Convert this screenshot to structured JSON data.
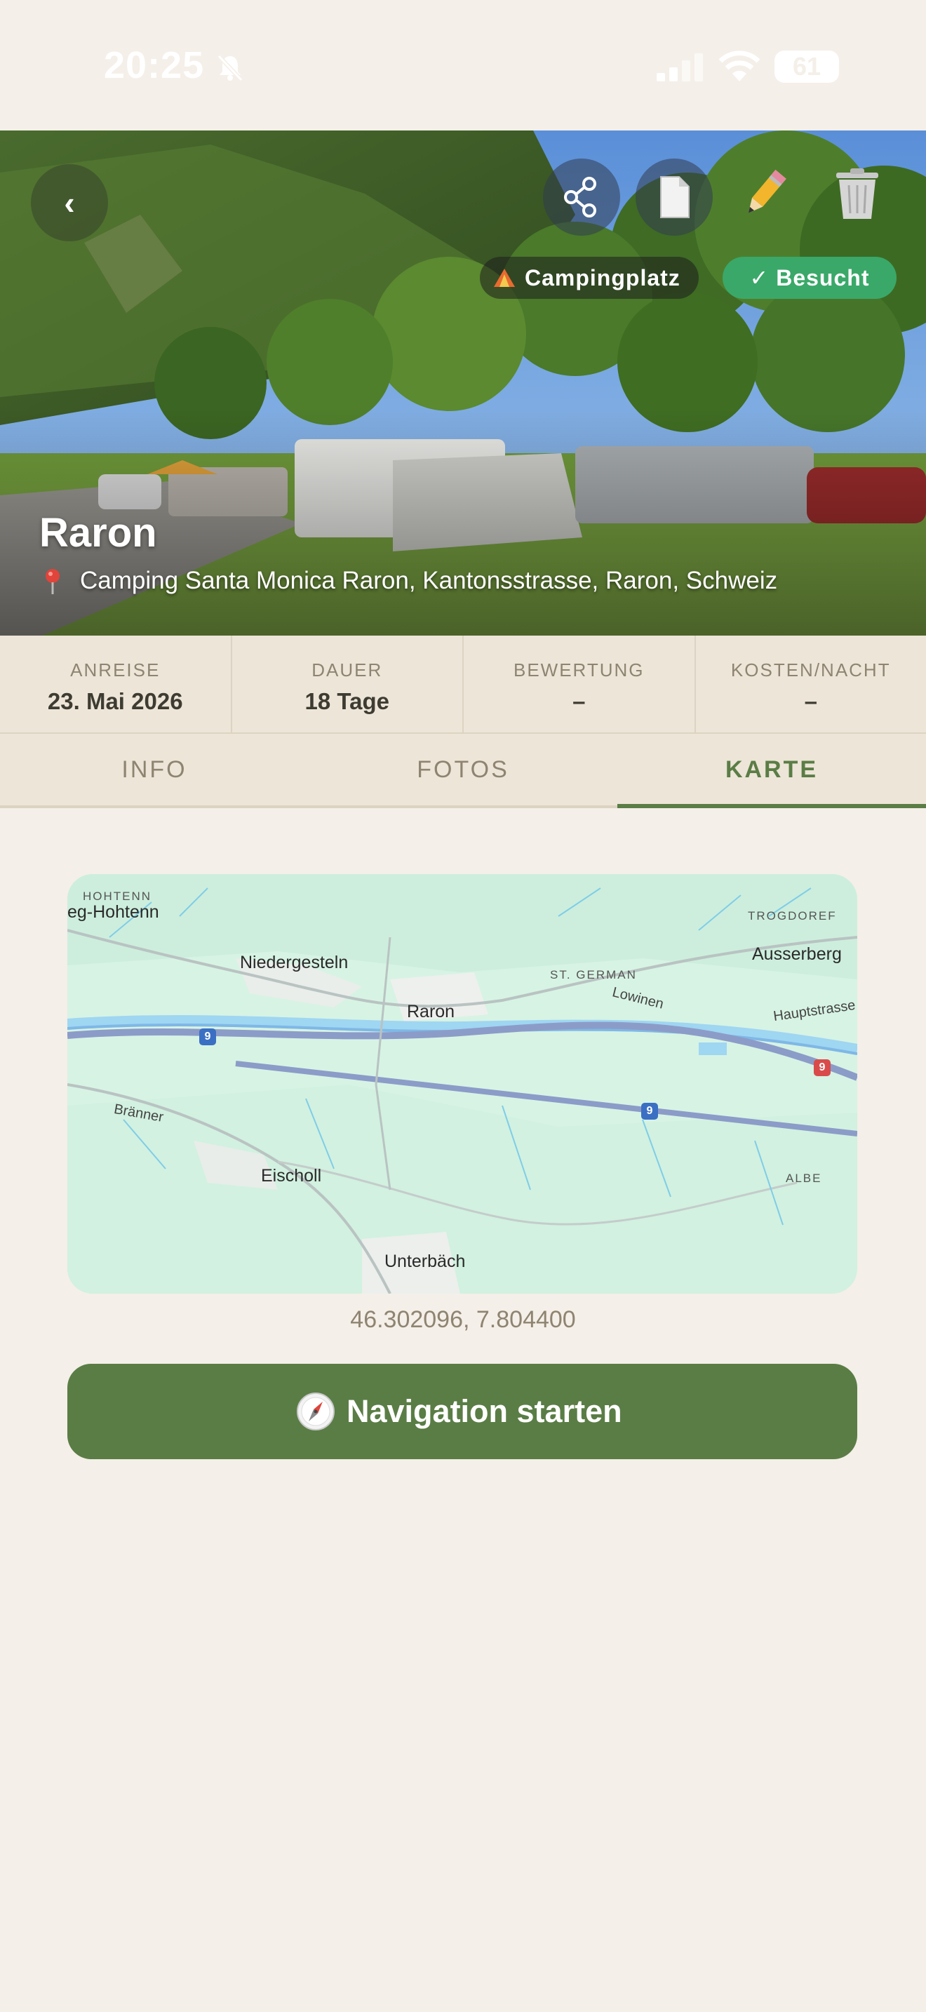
{
  "status_bar": {
    "time": "20:25",
    "battery": "61"
  },
  "hero": {
    "title": "Raron",
    "address": "Camping Santa Monica Raron, Kantonsstrasse, Raron, Schweiz",
    "category_badge": "Campingplatz",
    "visited_badge": "✓ Besucht",
    "back_icon": "‹"
  },
  "stats": [
    {
      "label": "ANREISE",
      "value": "23. Mai 2026"
    },
    {
      "label": "DAUER",
      "value": "18 Tage"
    },
    {
      "label": "BEWERTUNG",
      "value": "–"
    },
    {
      "label": "KOSTEN/NACHT",
      "value": "–"
    }
  ],
  "tabs": [
    {
      "label": "INFO",
      "active": false
    },
    {
      "label": "FOTOS",
      "active": false
    },
    {
      "label": "KARTE",
      "active": true
    }
  ],
  "map": {
    "labels": {
      "hohtenn_upper": "HOHTENN",
      "hohtenn": "eg-Hohtenn",
      "niedergesteln": "Niedergesteln",
      "raron": "Raron",
      "st_german": "ST. GERMAN",
      "lowinen": "Lowinen",
      "trogdoref": "TROGDOREF",
      "ausserberg": "Ausserberg",
      "hauptstrasse": "Hauptstrasse",
      "branner": "Bränner",
      "eischoll": "Eischoll",
      "albe": "ALBE",
      "unterbach": "Unterbäch"
    },
    "road_number": "9"
  },
  "coordinates": "46.302096, 7.804400",
  "navigation_button": "Navigation starten",
  "icons": [
    "bell-off-icon",
    "signal-icon",
    "wifi-icon",
    "battery-icon",
    "back-icon",
    "share-icon",
    "document-icon",
    "pencil-icon",
    "trash-icon",
    "tent-icon",
    "pin-icon",
    "compass-icon"
  ]
}
